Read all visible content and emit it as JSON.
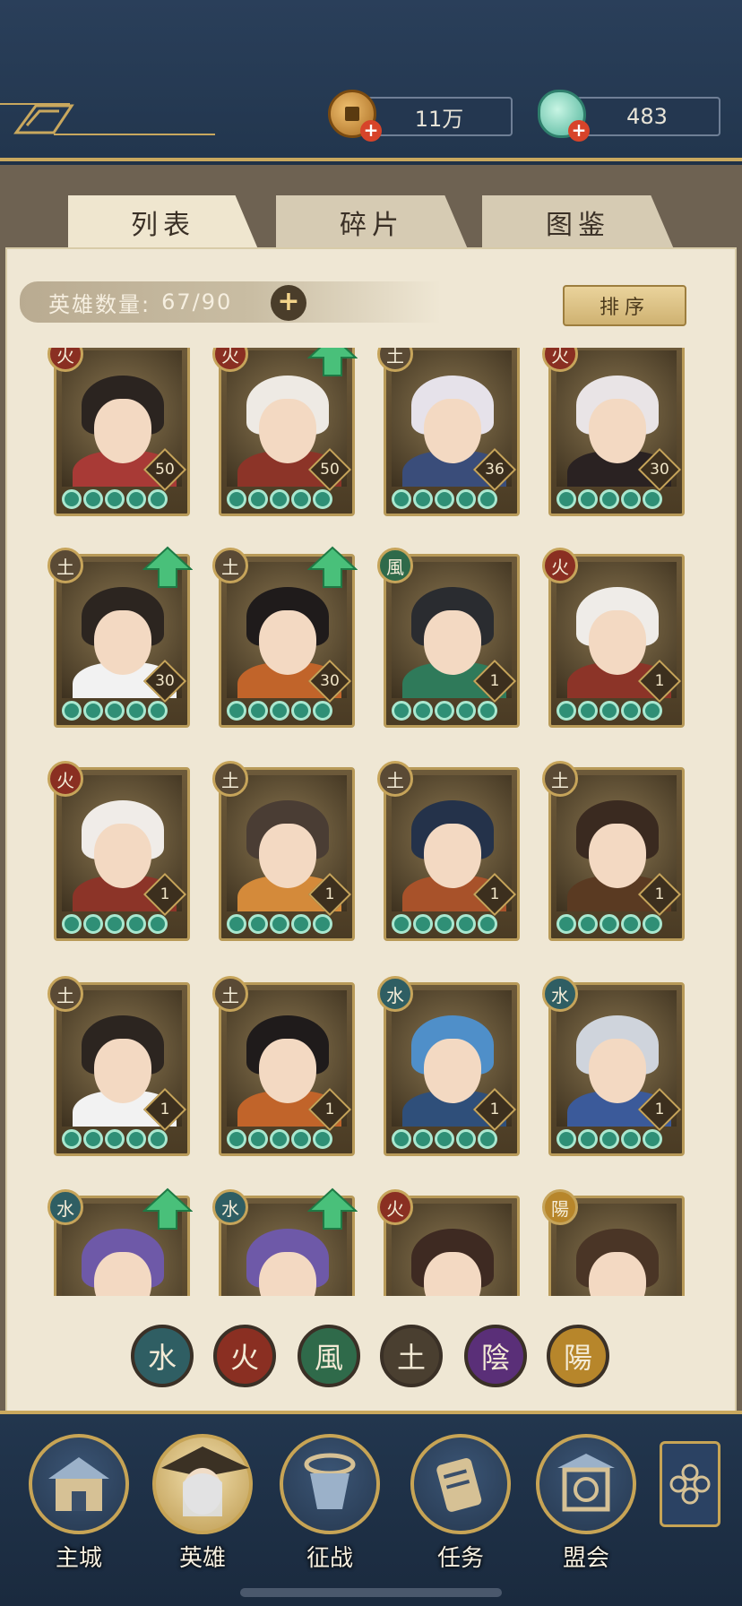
{
  "currency": {
    "coins": "11万",
    "jade": "483"
  },
  "tabs": [
    {
      "label": "列表",
      "active": true
    },
    {
      "label": "碎片",
      "active": false
    },
    {
      "label": "图鉴",
      "active": false
    }
  ],
  "hero_count": {
    "label": "英雄数量:",
    "value": "67/90"
  },
  "sort_label": "排序",
  "cards": [
    {
      "element": "火",
      "level": "50",
      "up": false
    },
    {
      "element": "火",
      "level": "50",
      "up": true
    },
    {
      "element": "土",
      "level": "36",
      "up": false
    },
    {
      "element": "火",
      "level": "30",
      "up": false
    },
    {
      "element": "土",
      "level": "30",
      "up": true
    },
    {
      "element": "土",
      "level": "30",
      "up": true
    },
    {
      "element": "風",
      "level": "1",
      "up": false
    },
    {
      "element": "火",
      "level": "1",
      "up": false
    },
    {
      "element": "火",
      "level": "1",
      "up": false
    },
    {
      "element": "土",
      "level": "1",
      "up": false
    },
    {
      "element": "土",
      "level": "1",
      "up": false
    },
    {
      "element": "土",
      "level": "1",
      "up": false
    },
    {
      "element": "土",
      "level": "1",
      "up": false
    },
    {
      "element": "土",
      "level": "1",
      "up": false
    },
    {
      "element": "水",
      "level": "1",
      "up": false
    },
    {
      "element": "水",
      "level": "1",
      "up": false
    },
    {
      "element": "水",
      "level": "",
      "up": true
    },
    {
      "element": "水",
      "level": "",
      "up": true
    },
    {
      "element": "火",
      "level": "",
      "up": false
    },
    {
      "element": "陽",
      "level": "",
      "up": false
    }
  ],
  "filters": [
    {
      "glyph": "水",
      "color": "#2f5e63"
    },
    {
      "glyph": "火",
      "color": "#8a2f22"
    },
    {
      "glyph": "風",
      "color": "#2f6a4a"
    },
    {
      "glyph": "土",
      "color": "#4a3f30"
    },
    {
      "glyph": "陰",
      "color": "#5a2f78"
    },
    {
      "glyph": "陽",
      "color": "#b7862b"
    }
  ],
  "nav": [
    {
      "label": "主城",
      "active": false
    },
    {
      "label": "英雄",
      "active": true
    },
    {
      "label": "征战",
      "active": false
    },
    {
      "label": "任务",
      "active": false
    },
    {
      "label": "盟会",
      "active": false
    }
  ]
}
